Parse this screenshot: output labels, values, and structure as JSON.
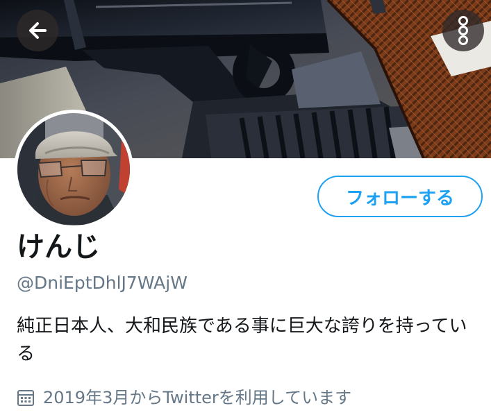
{
  "header": {
    "back_icon": "arrow-left-icon",
    "more_icon": "more-vertical-icon"
  },
  "profile": {
    "display_name": "けんじ",
    "handle": "@DniEptDhlJ7WAjW",
    "bio": "純正日本人、大和民族である事に巨大な誇りを持っている",
    "joined": "2019年3月からTwitterを利用しています",
    "follow_label": "フォローする"
  },
  "colors": {
    "accent": "#1da1f2",
    "secondary_text": "#657786",
    "primary_text": "#14171a"
  }
}
